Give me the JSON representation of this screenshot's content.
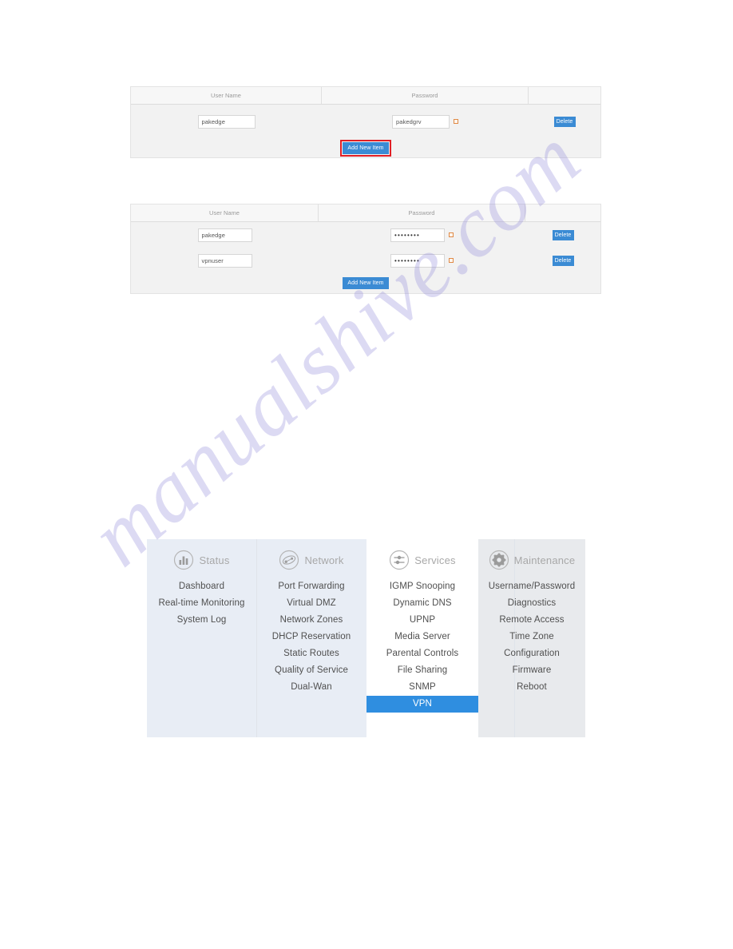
{
  "watermark": {
    "text": "manualshive.com"
  },
  "table_top": {
    "columns": [
      "User Name",
      "Password",
      ""
    ],
    "rows": [
      {
        "username": "pakedge",
        "password": "pakedgrv",
        "delete_label": "Delete",
        "masked": false
      }
    ],
    "add_label": "Add New Item",
    "add_highlighted": true
  },
  "table_bottom": {
    "columns": [
      "User Name",
      "Password",
      ""
    ],
    "rows": [
      {
        "username": "pakedge",
        "password": "••••••••",
        "delete_label": "Delete",
        "masked": true
      },
      {
        "username": "vpnuser",
        "password": "••••••••",
        "delete_label": "Delete",
        "masked": true
      }
    ],
    "add_label": "Add New Item",
    "add_highlighted": false
  },
  "nav": {
    "active_item": "VPN",
    "accent_color": "#2f8ee0",
    "columns": [
      {
        "title": "Status",
        "icon": "bar-chart-icon",
        "items": [
          "Dashboard",
          "Real-time Monitoring",
          "System Log"
        ]
      },
      {
        "title": "Network",
        "icon": "network-globe-icon",
        "items": [
          "Port Forwarding",
          "Virtual DMZ",
          "Network Zones",
          "DHCP Reservation",
          "Static Routes",
          "Quality of Service",
          "Dual-Wan"
        ]
      },
      {
        "title": "Services",
        "icon": "sliders-icon",
        "items": [
          "IGMP Snooping",
          "Dynamic DNS",
          "UPNP",
          "Media Server",
          "Parental Controls",
          "File Sharing",
          "SNMP",
          "VPN"
        ]
      },
      {
        "title": "Maintenance",
        "icon": "gear-icon",
        "items": [
          "Username/Password",
          "Diagnostics",
          "Remote Access",
          "Time Zone",
          "Configuration",
          "Firmware",
          "Reboot"
        ]
      }
    ]
  }
}
